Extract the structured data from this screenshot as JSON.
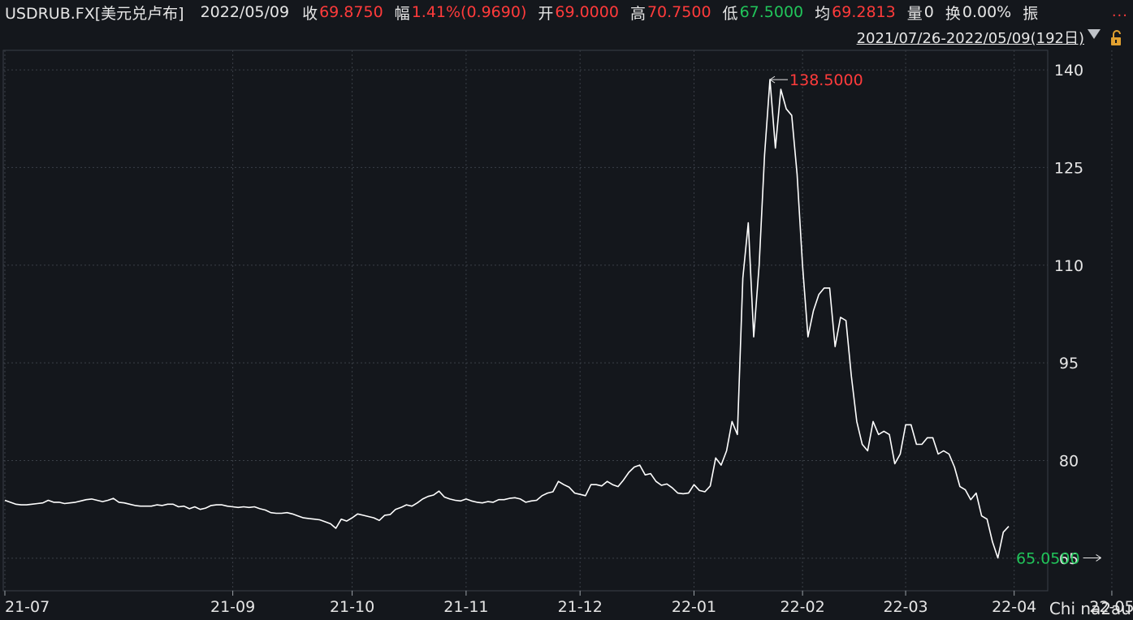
{
  "header": {
    "symbol": "USDRUB.FX[美元兑卢布]",
    "date": "2022/05/09",
    "close_label": "收",
    "close_value": "69.8750",
    "change_label": "幅",
    "change_value": "1.41%(0.9690)",
    "open_label": "开",
    "open_value": "69.0000",
    "high_label": "高",
    "high_value": "70.7500",
    "low_label": "低",
    "low_value": "67.5000",
    "avg_label": "均",
    "avg_value": "69.2813",
    "volume_label": "量",
    "volume_value": "0",
    "turnover_label": "换",
    "turnover_value": "0.00%",
    "amplitude_label": "振",
    "more": "...",
    "range": "2021/07/26-2022/05/09(192日)"
  },
  "watermark": "Chi na2au",
  "colors": {
    "background": "#14171c",
    "up": "#ff3b3b",
    "down": "#21c45a",
    "line": "#ffffff",
    "grid": "#3a3f47"
  },
  "chart_data": {
    "type": "line",
    "series": [
      {
        "values": [
          73.9,
          73.6,
          73.3,
          73.2,
          73.2,
          73.3,
          73.4,
          73.5,
          73.9,
          73.6,
          73.6,
          73.4,
          73.5,
          73.6,
          73.8,
          74.0,
          74.1,
          73.9,
          73.7,
          73.9,
          74.2,
          73.6,
          73.5,
          73.3,
          73.1,
          73.0,
          73.0,
          73.0,
          73.2,
          73.1,
          73.3,
          73.3,
          72.9,
          73.0,
          72.6,
          72.9,
          72.5,
          72.7,
          73.1,
          73.2,
          73.2,
          73.0,
          72.9,
          72.8,
          72.9,
          72.8,
          72.9,
          72.6,
          72.4,
          72.0,
          71.9,
          71.9,
          72.0,
          71.8,
          71.5,
          71.2,
          71.1,
          71.0,
          70.9,
          70.6,
          70.3,
          69.6,
          71.0,
          70.7,
          71.2,
          71.8,
          71.6,
          71.4,
          71.2,
          70.8,
          71.6,
          71.7,
          72.5,
          72.8,
          73.2,
          73.0,
          73.5,
          74.1,
          74.5,
          74.7,
          75.3,
          74.4,
          74.1,
          73.9,
          73.8,
          74.1,
          73.8,
          73.6,
          73.5,
          73.7,
          73.6,
          74.0,
          74.0,
          74.2,
          74.3,
          74.1,
          73.6,
          73.8,
          73.9,
          74.6,
          75.0,
          75.2,
          76.8,
          76.3,
          75.9,
          75.0,
          74.8,
          74.6,
          76.3,
          76.3,
          76.1,
          76.8,
          76.3,
          76.0,
          77.0,
          78.2,
          79.0,
          79.3,
          77.8,
          78.0,
          76.8,
          76.2,
          76.4,
          75.8,
          75.0,
          74.9,
          75.0,
          76.3,
          75.4,
          75.2,
          76.1,
          80.4,
          79.3,
          81.5,
          86.0,
          84.0,
          108.0,
          116.5,
          99.0,
          110.0,
          127.0,
          138.5,
          128.0,
          137.0,
          134.0,
          133.0,
          124.0,
          110.0,
          99.0,
          103.0,
          105.5,
          106.5,
          106.5,
          97.5,
          102.0,
          101.5,
          93.0,
          86.0,
          82.5,
          81.5,
          86.0,
          84.0,
          84.5,
          84.0,
          79.5,
          81.0,
          85.5,
          85.5,
          82.5,
          82.5,
          83.5,
          83.5,
          81.0,
          81.5,
          81.0,
          79.0,
          76.0,
          75.5,
          74.0,
          75.0,
          71.5,
          71.0,
          67.5,
          65.05,
          69.0,
          69.9
        ]
      }
    ],
    "x_range": [
      "2021/07/26",
      "2022/05/09"
    ],
    "x_tick_labels": [
      "21-07",
      "21-09",
      "21-10",
      "21-11",
      "21-12",
      "22-01",
      "22-02",
      "22-03",
      "22-04",
      "22-05"
    ],
    "x_tick_index": [
      0,
      42,
      64,
      85,
      106,
      127,
      147,
      166,
      186,
      204
    ],
    "y_ticks": [
      65,
      80,
      95,
      110,
      125,
      140
    ],
    "ylim": [
      60,
      143
    ],
    "grid": true,
    "annotations": [
      {
        "label": "138.5000",
        "index": 141,
        "value": 138.5,
        "color": "up"
      },
      {
        "label": "65.0500",
        "index": 202,
        "value": 65.05,
        "color": "down"
      }
    ]
  }
}
